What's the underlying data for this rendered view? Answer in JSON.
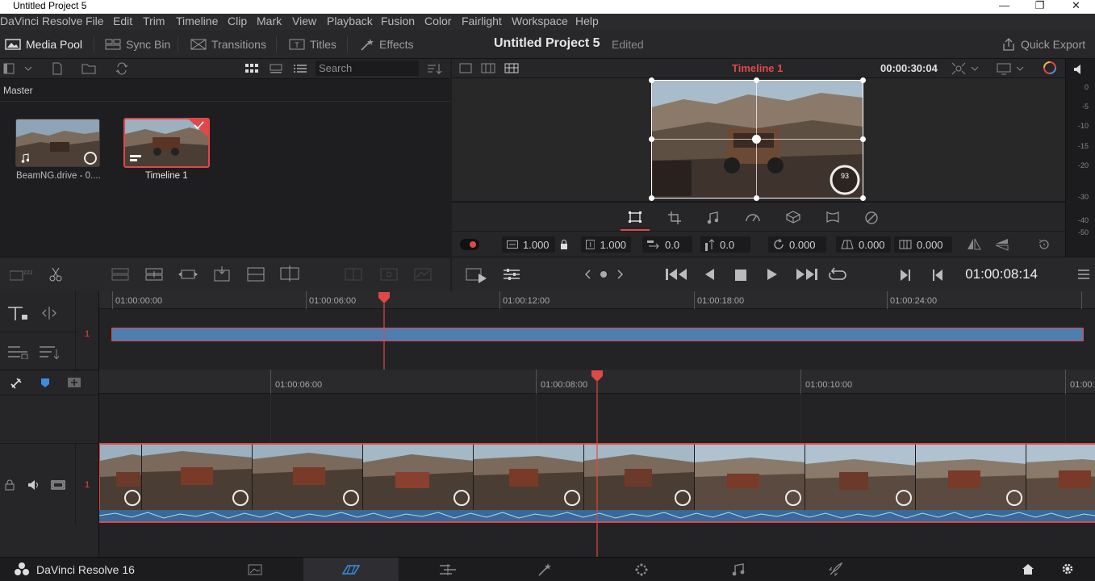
{
  "window": {
    "title": "Untitled Project 5"
  },
  "menu": [
    "DaVinci Resolve",
    "File",
    "Edit",
    "Trim",
    "Timeline",
    "Clip",
    "Mark",
    "View",
    "Playback",
    "Fusion",
    "Color",
    "Fairlight",
    "Workspace",
    "Help"
  ],
  "toolbar": {
    "media_pool": "Media Pool",
    "sync_bin": "Sync Bin",
    "transitions": "Transitions",
    "titles": "Titles",
    "effects": "Effects",
    "project_title": "Untitled Project 5",
    "project_status": "Edited",
    "quick_export": "Quick Export"
  },
  "media_pool": {
    "search_placeholder": "Search",
    "bin": "Master",
    "clips": [
      {
        "name": "BeamNG.drive - 0...."
      },
      {
        "name": "Timeline 1"
      }
    ]
  },
  "viewer": {
    "timeline_name": "Timeline 1",
    "duration": "00:00:30:04",
    "zoom_x": "1.000",
    "zoom_y": "1.000",
    "position_x": "0.0",
    "position_y": "0.0",
    "rotation": "0.000",
    "pitch": "0.000",
    "yaw": "0.000"
  },
  "audio_meter": {
    "ticks": [
      "0",
      "-5",
      "-10",
      "-15",
      "-20",
      "-30",
      "-40",
      "-50"
    ]
  },
  "transport": {
    "timecode": "01:00:08:14"
  },
  "upper_timeline": {
    "ruler": [
      "01:00:00:00",
      "01:00:06:00",
      "01:00:12:00",
      "01:00:18:00",
      "01:00:24:00"
    ],
    "track_number": "1"
  },
  "lower_timeline": {
    "ruler": [
      "01:00:06:00",
      "01:00:08:00",
      "01:00:10:00",
      "01:00:"
    ],
    "track_number": "1"
  },
  "footer": {
    "app_name": "DaVinci Resolve 16"
  },
  "colors": {
    "accent_red": "#e04848",
    "clip_blue": "#4e7db0",
    "panel": "#28282b"
  }
}
